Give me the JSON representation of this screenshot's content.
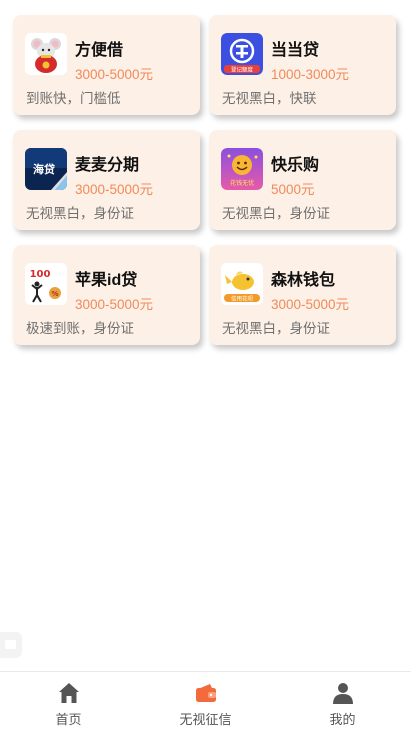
{
  "products": [
    {
      "name": "方便借",
      "amount": "3000-5000元",
      "desc": "到账快，门槛低",
      "icon": "mouse-money-bag-icon"
    },
    {
      "name": "当当贷",
      "amount": "1000-3000元",
      "desc": "无视黑白，快联",
      "icon": "dangdang-loan-icon",
      "logo_caption": "登记额度"
    },
    {
      "name": "麦麦分期",
      "amount": "3000-5000元",
      "desc": "无视黑白，身份证",
      "icon": "haidai-icon",
      "logo_caption": "海贷"
    },
    {
      "name": "快乐购",
      "amount": "5000元",
      "desc": "无视黑白，身份证",
      "icon": "kuailegou-icon",
      "logo_caption": "花钱无忧"
    },
    {
      "name": "苹果id贷",
      "amount": "3000-5000元",
      "desc": "极速到账，身份证",
      "icon": "apple-id-loan-icon",
      "logo_caption": "100"
    },
    {
      "name": "森林钱包",
      "amount": "3000-5000元",
      "desc": "无视黑白，身份证",
      "icon": "forest-wallet-icon",
      "logo_caption": "信用花呗"
    }
  ],
  "tabbar": [
    {
      "label": "首页",
      "icon": "home-icon",
      "active": false
    },
    {
      "label": "无视征信",
      "icon": "wallet-icon",
      "active": true
    },
    {
      "label": "我的",
      "icon": "user-icon",
      "active": false
    }
  ],
  "colors": {
    "card_bg": "#fdf0e6",
    "amount": "#f08a5a",
    "active_icon": "#f36b3d",
    "inactive_icon": "#555555"
  }
}
